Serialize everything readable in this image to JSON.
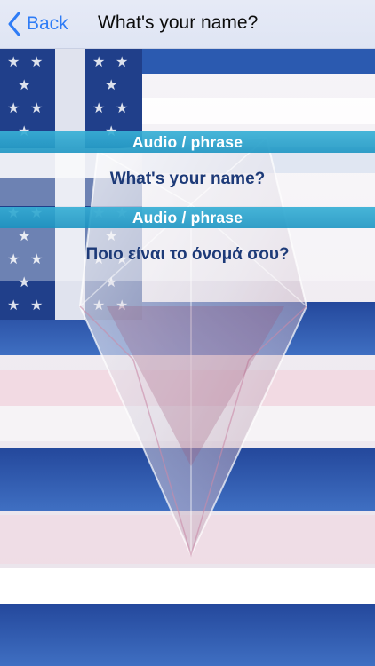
{
  "nav": {
    "back_label": "Back",
    "title": "What's your name?"
  },
  "rows": {
    "audio_1": "Audio / phrase",
    "phrase_english": "What's your name?",
    "audio_2": "Audio / phrase",
    "phrase_greek": "Ποιο είναι το όνομά σου?"
  },
  "colors": {
    "accent": "#2f7cf6",
    "audio_bar": "#2a9fcb",
    "phrase_text": "#1d3a78"
  },
  "icons": {
    "back": "chevron-left-icon"
  }
}
